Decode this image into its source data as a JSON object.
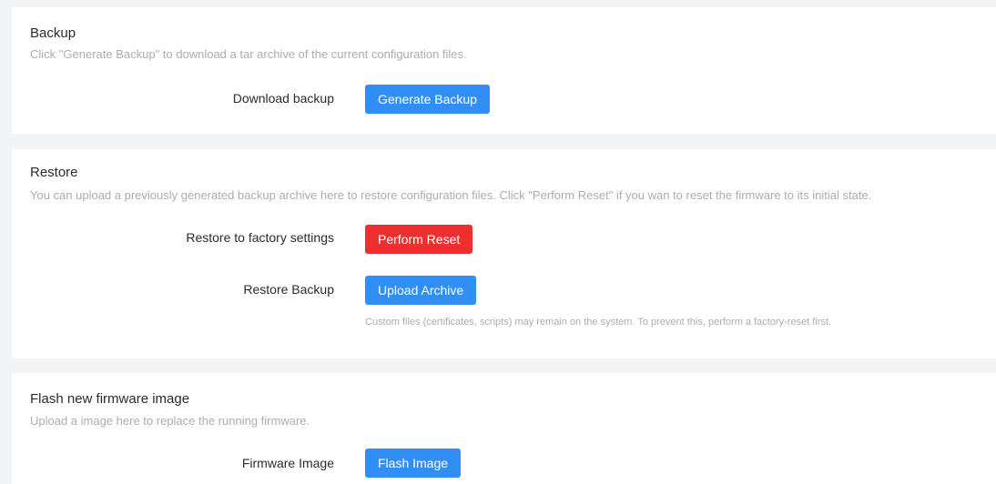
{
  "backup": {
    "title": "Backup",
    "description": "Click \"Generate Backup\" to download a tar archive of the current configuration files.",
    "download_label": "Download backup",
    "generate_button": "Generate Backup"
  },
  "restore": {
    "title": "Restore",
    "description": "You can upload a previously generated backup archive here to restore configuration files. Click \"Perform Reset\" if you wan to reset the firmware to its initial state.",
    "factory_label": "Restore to factory settings",
    "reset_button": "Perform Reset",
    "restore_backup_label": "Restore Backup",
    "upload_button": "Upload Archive",
    "hint": "Custom files (certificates, scripts) may remain on the system. To prevent this, perform a factory-reset first."
  },
  "firmware": {
    "title": "Flash new firmware image",
    "description": "Upload a image here to replace the running firmware.",
    "image_label": "Firmware Image",
    "flash_button": "Flash Image"
  },
  "colors": {
    "primary": "#2f8ff5",
    "danger": "#ee2f2f",
    "muted_text": "#a9adb3",
    "page_background": "#f3f4f6"
  }
}
